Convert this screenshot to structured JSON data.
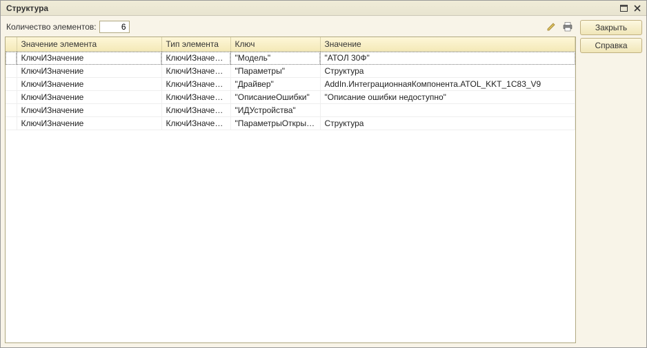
{
  "window": {
    "title": "Структура"
  },
  "toolbar": {
    "count_label": "Количество элементов:",
    "count_value": "6"
  },
  "buttons": {
    "close": "Закрыть",
    "help": "Справка"
  },
  "table": {
    "headers": {
      "elem_value": "Значение элемента",
      "elem_type": "Тип элемента",
      "key": "Ключ",
      "value": "Значение"
    },
    "rows": [
      {
        "elem_value": "КлючИЗначение",
        "elem_type": "КлючИЗначение",
        "key": "\"Модель\"",
        "value": "\"АТОЛ 30Ф\""
      },
      {
        "elem_value": "КлючИЗначение",
        "elem_type": "КлючИЗначение",
        "key": "\"Параметры\"",
        "value": "Структура"
      },
      {
        "elem_value": "КлючИЗначение",
        "elem_type": "КлючИЗначение",
        "key": "\"Драйвер\"",
        "value": "AddIn.ИнтеграционнаяКомпонента.ATOL_KKT_1C83_V9"
      },
      {
        "elem_value": "КлючИЗначение",
        "elem_type": "КлючИЗначение",
        "key": "\"ОписаниеОшибки\"",
        "value": "\"Описание ошибки недоступно\""
      },
      {
        "elem_value": "КлючИЗначение",
        "elem_type": "КлючИЗначение",
        "key": "\"ИДУстройства\"",
        "value": ""
      },
      {
        "elem_value": "КлючИЗначение",
        "elem_type": "КлючИЗначение",
        "key": "\"ПараметрыОткрытия…",
        "value": "Структура"
      }
    ]
  }
}
